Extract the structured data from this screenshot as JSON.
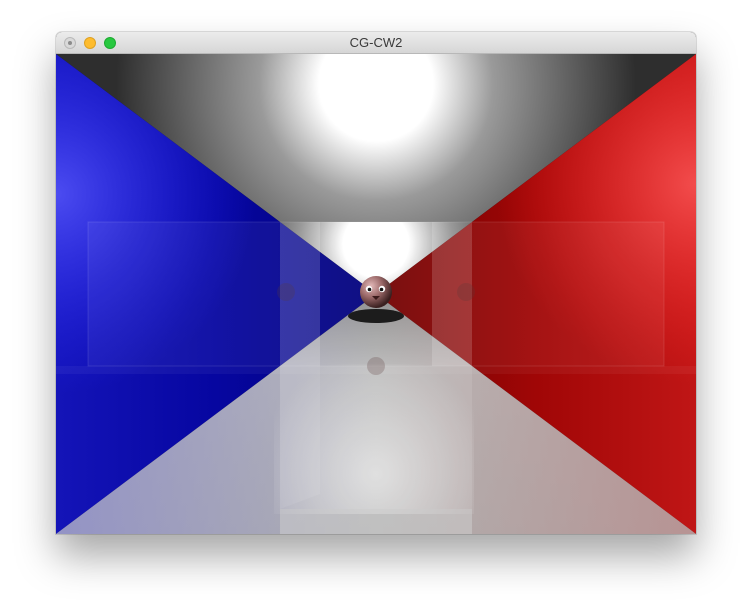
{
  "window": {
    "title": "CG-CW2",
    "controls": {
      "close": "close-button",
      "minimize": "minimize-button",
      "maximize": "maximize-button"
    }
  },
  "scene": {
    "description_colors": {
      "left_wall": "#0a0aa8",
      "right_wall": "#a00808",
      "ceiling": "#333333",
      "floor": "#bdbdbd",
      "light": "#ffffff"
    }
  }
}
